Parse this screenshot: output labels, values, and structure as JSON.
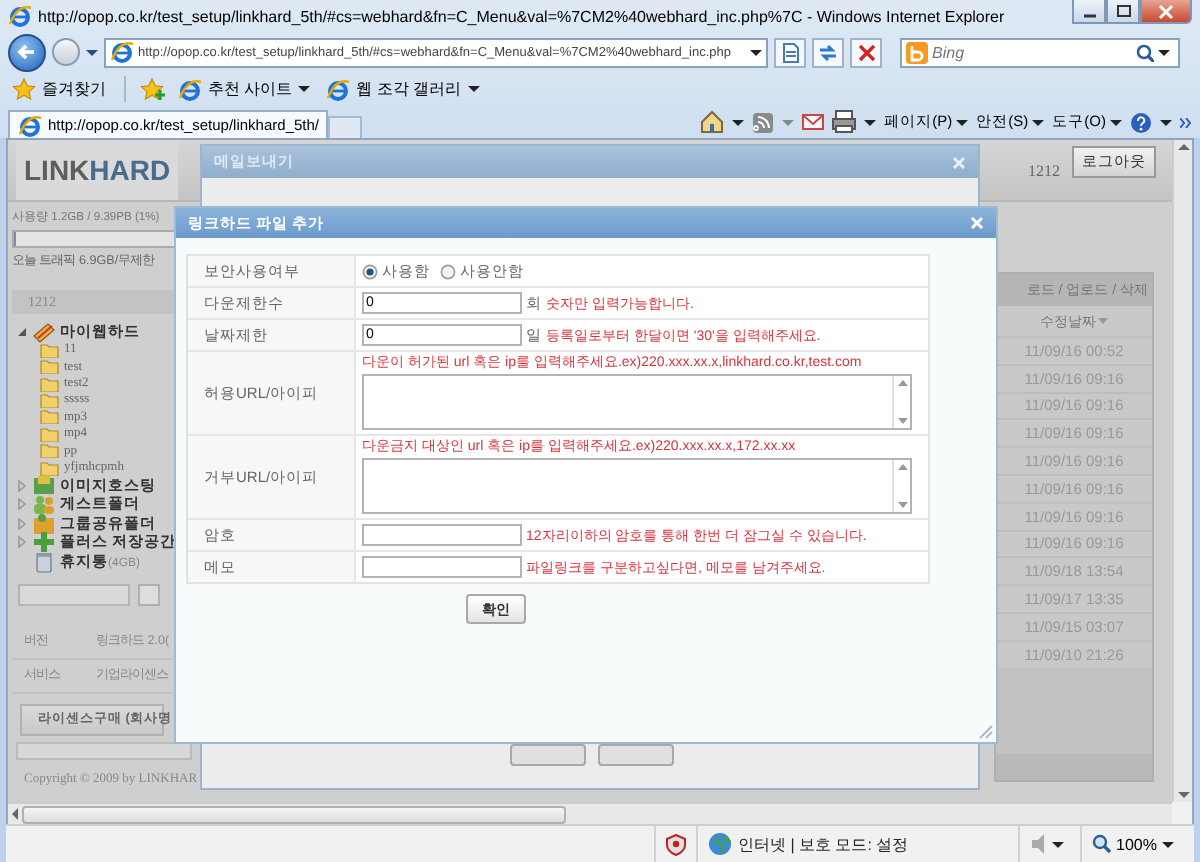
{
  "browser": {
    "title": "http://opop.co.kr/test_setup/linkhard_5th/#cs=webhard&fn=C_Menu&val=%7CM2%40webhard_inc.php%7C - Windows Internet Explorer",
    "address": "http://opop.co.kr/test_setup/linkhard_5th/#cs=webhard&fn=C_Menu&val=%7CM2%40webhard_inc.php",
    "search": {
      "placeholder": "Bing"
    },
    "favorites": {
      "label": "즐겨찾기",
      "links": [
        "추천 사이트",
        "웹 조각 갤러리"
      ]
    },
    "tabs": [
      {
        "label": "http://opop.co.kr/test_setup/linkhard_5th/",
        "selected": true
      }
    ],
    "menus": [
      "페이지(P)",
      "안전(S)",
      "도구(O)"
    ]
  },
  "page": {
    "logo": [
      "LINK",
      "HARD"
    ],
    "user": "1212",
    "logout": "로그아웃",
    "sidebar": {
      "usage": {
        "text": "사용량 1.2GB / 9.39PB (1%)",
        "level": 0.01
      },
      "traffic": "오늘 트래픽 6.9GB/무제한",
      "panel_title": "1212",
      "tree": [
        {
          "label": "마이웹하드",
          "kind": "drive",
          "expanded": true,
          "children": [
            {
              "label": "11"
            },
            {
              "label": "test"
            },
            {
              "label": "test2"
            },
            {
              "label": "sssss"
            },
            {
              "label": "mp3"
            },
            {
              "label": "mp4"
            },
            {
              "label": "pp"
            },
            {
              "label": "yfjmhcpmh"
            }
          ]
        },
        {
          "label": "이미지호스팅",
          "kind": "image",
          "expanded": false
        },
        {
          "label": "게스트폴더",
          "kind": "guest",
          "expanded": false
        },
        {
          "label": "그룹공유폴더",
          "kind": "group",
          "expanded": false
        },
        {
          "label": "플러스 저장공간",
          "kind": "plus",
          "expanded": false
        },
        {
          "label": "휴지통",
          "kind": "trash",
          "note": "(4GB)"
        }
      ],
      "info": [
        {
          "label": "버전",
          "value": "링크하드 2.0("
        },
        {
          "label": "서비스",
          "value": "기업라이센스"
        }
      ],
      "license_button": "라이센스구매 (회사명",
      "copyright": "Copyright © 2009 by LINKHAR"
    },
    "files": {
      "toolbar": "로드 / 업로드 / 삭제",
      "columns": [
        "수정날짜"
      ],
      "rows": [
        "11/09/16 00:52",
        "11/09/16 09:16",
        "11/09/16 09:16",
        "11/09/16 09:16",
        "11/09/16 09:16",
        "11/09/16 09:16",
        "11/09/16 09:16",
        "11/09/16 09:16",
        "11/09/18 13:54",
        "11/09/17 13:35",
        "11/09/15 03:07",
        "11/09/10 21:26"
      ]
    }
  },
  "mail_dialog": {
    "title": "메일보내기"
  },
  "file_dialog": {
    "title": "링크하드 파일 추가",
    "rows": [
      {
        "kind": "radio",
        "label": "보안사용여부",
        "options": [
          {
            "label": "사용함",
            "selected": true
          },
          {
            "label": "사용안함",
            "selected": false
          }
        ]
      },
      {
        "kind": "input",
        "label": "다운제한수",
        "value": "0",
        "unit": "회",
        "hint": "숫자만 입력가능합니다."
      },
      {
        "kind": "input",
        "label": "날짜제한",
        "value": "0",
        "unit": "일",
        "hint": "등록일로부터 한달이면 '30'을 입력해주세요."
      },
      {
        "kind": "textarea",
        "label": "허용URL/아이피",
        "hint": "다운이 허가된 url 혹은 ip를 입력해주세요.ex)220.xxx.xx.x,linkhard.co.kr,test.com"
      },
      {
        "kind": "textarea",
        "label": "거부URL/아이피",
        "hint": "다운금지 대상인 url 혹은 ip를 입력해주세요.ex)220.xxx.xx.x,172.xx.xx"
      },
      {
        "kind": "input",
        "label": "암호",
        "hint": "12자리이하의 암호를 통해 한번 더 잠그실 수 있습니다."
      },
      {
        "kind": "input",
        "label": "메모",
        "hint": "파일링크를 구분하고싶다면, 메모를 남겨주세요."
      }
    ],
    "button": "확인"
  },
  "status_bar": {
    "zone": "인터넷 | 보호 모드: 설정",
    "zoom": "100%"
  }
}
